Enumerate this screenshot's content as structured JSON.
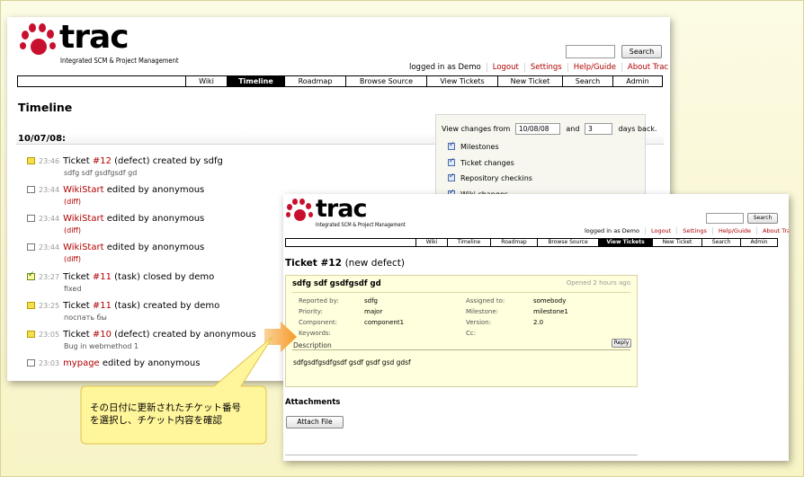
{
  "timeline_window": {
    "logo": {
      "word": "trac",
      "subtitle": "Integrated SCM & Project Management"
    },
    "search": {
      "button": "Search"
    },
    "metanav": {
      "logged_in": "logged in as Demo",
      "logout": "Logout",
      "settings": "Settings",
      "help": "Help/Guide",
      "about": "About Trac"
    },
    "mainnav": [
      "Wiki",
      "Timeline",
      "Roadmap",
      "Browse Source",
      "View Tickets",
      "New Ticket",
      "Search",
      "Admin"
    ],
    "title": "Timeline",
    "date_header": "10/07/08:",
    "filters": {
      "view_changes_from": "View changes from",
      "from_date": "10/08/08",
      "and": "and",
      "days": "3",
      "days_back": "days back.",
      "options": [
        "Milestones",
        "Ticket changes",
        "Repository checkins",
        "Wiki changes"
      ]
    },
    "events": [
      {
        "icon": "ticket-icon",
        "time": "23:46",
        "pre": "Ticket ",
        "link": "#12",
        "post": " (defect) created by sdfg",
        "sub": "sdfg sdf gsdfgsdf gd",
        "sub_link": false
      },
      {
        "icon": "wiki-icon",
        "time": "23:44",
        "pre": "",
        "link": "WikiStart",
        "post": " edited by anonymous",
        "sub": "(diff)",
        "sub_link": true
      },
      {
        "icon": "wiki-icon",
        "time": "23:44",
        "pre": "",
        "link": "WikiStart",
        "post": " edited by anonymous",
        "sub": "(diff)",
        "sub_link": true
      },
      {
        "icon": "wiki-icon",
        "time": "23:44",
        "pre": "",
        "link": "WikiStart",
        "post": " edited by anonymous",
        "sub": "(diff)",
        "sub_link": true
      },
      {
        "icon": "closed-ticket-icon",
        "time": "23:27",
        "pre": "Ticket ",
        "link": "#11",
        "post": " (task) closed by demo",
        "sub": "fixed",
        "sub_link": false
      },
      {
        "icon": "ticket-icon",
        "time": "23:25",
        "pre": "Ticket ",
        "link": "#11",
        "post": " (task) created by demo",
        "sub": "поспать бы",
        "sub_link": false
      },
      {
        "icon": "ticket-icon",
        "time": "23:05",
        "pre": "Ticket ",
        "link": "#10",
        "post": " (defect) created by anonymous",
        "sub": "Bug in webmethod 1",
        "sub_link": false
      },
      {
        "icon": "wiki-icon",
        "time": "23:03",
        "pre": "",
        "link": "mypage",
        "post": " edited by anonymous",
        "sub": "",
        "sub_link": false
      }
    ]
  },
  "ticket_window": {
    "logo": {
      "word": "trac",
      "subtitle": "Integrated SCM & Project Management"
    },
    "search": {
      "button": "Search"
    },
    "metanav": {
      "logged_in": "logged in as Demo",
      "logout": "Logout",
      "settings": "Settings",
      "help": "Help/Guide",
      "about": "About Trac"
    },
    "mainnav": [
      "Wiki",
      "Timeline",
      "Roadmap",
      "Browse Source",
      "View Tickets",
      "New Ticket",
      "Search",
      "Admin"
    ],
    "title": "Ticket #12",
    "status": "(new defect)",
    "ticket": {
      "summary": "sdfg sdf gsdfgsdf gd",
      "opened": "Opened 2 hours ago",
      "fields_left": [
        {
          "label": "Reported by:",
          "value": "sdfg"
        },
        {
          "label": "Priority:",
          "value": "major"
        },
        {
          "label": "Component:",
          "value": "component1"
        },
        {
          "label": "Keywords:",
          "value": ""
        }
      ],
      "fields_right": [
        {
          "label": "Assigned to:",
          "value": "somebody"
        },
        {
          "label": "Milestone:",
          "value": "milestone1"
        },
        {
          "label": "Version:",
          "value": "2.0"
        },
        {
          "label": "Cc:",
          "value": ""
        }
      ],
      "description_heading": "Description",
      "reply": "Reply",
      "description": "sdfgsdfgsdfgsdf gsdf gsdf gsd gdsf"
    },
    "attachments": {
      "heading": "Attachments",
      "button": "Attach File"
    }
  },
  "callout": {
    "line1": "その日付に更新されたチケット番号",
    "line2": "を選択し、チケット内容を確認",
    "fill": "#fff59a",
    "stroke": "#e0c24a",
    "arrow_color": "#f59a2a"
  }
}
